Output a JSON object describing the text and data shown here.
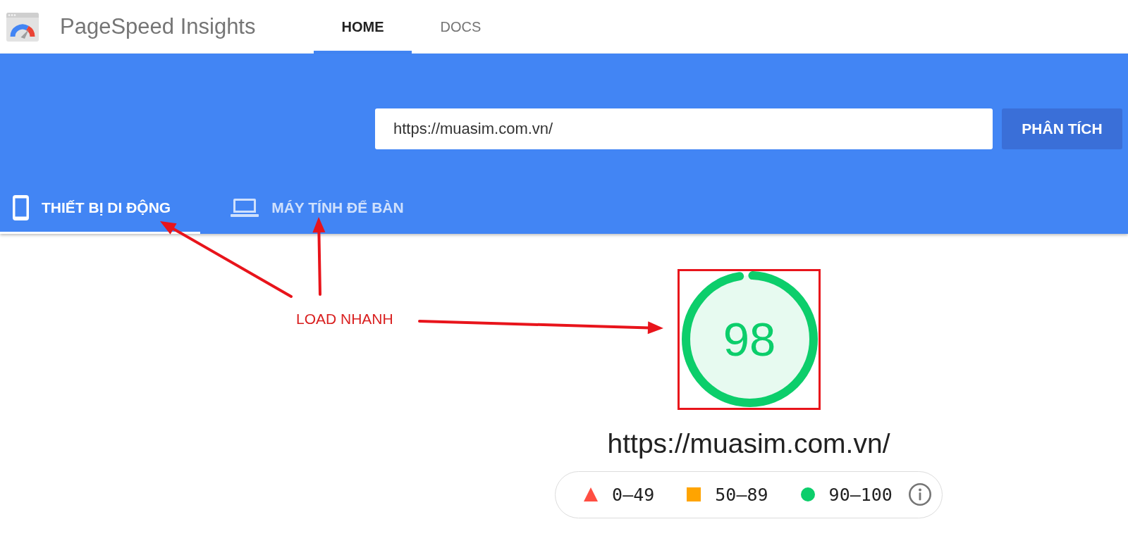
{
  "header": {
    "title": "PageSpeed Insights",
    "nav": [
      {
        "label": "HOME",
        "selected": true
      },
      {
        "label": "DOCS",
        "selected": false
      }
    ]
  },
  "search": {
    "value": "https://muasim.com.vn/",
    "button": "PHÂN TÍCH"
  },
  "device_tabs": [
    {
      "label": "THIẾT BỊ DI ĐỘNG",
      "kind": "phone",
      "selected": true
    },
    {
      "label": "MÁY TÍNH ĐỂ BÀN",
      "kind": "laptop",
      "selected": false
    }
  ],
  "annotation": {
    "label": "LOAD NHANH"
  },
  "score": {
    "value": "98",
    "level": 0.98
  },
  "result_url": "https://muasim.com.vn/",
  "legend": [
    {
      "kind": "triangle",
      "label": "0–49",
      "color": "#ff4e42"
    },
    {
      "kind": "square",
      "label": "50–89",
      "color": "#ffa400"
    },
    {
      "kind": "circle",
      "label": "90–100",
      "color": "#0cce6b"
    }
  ]
}
